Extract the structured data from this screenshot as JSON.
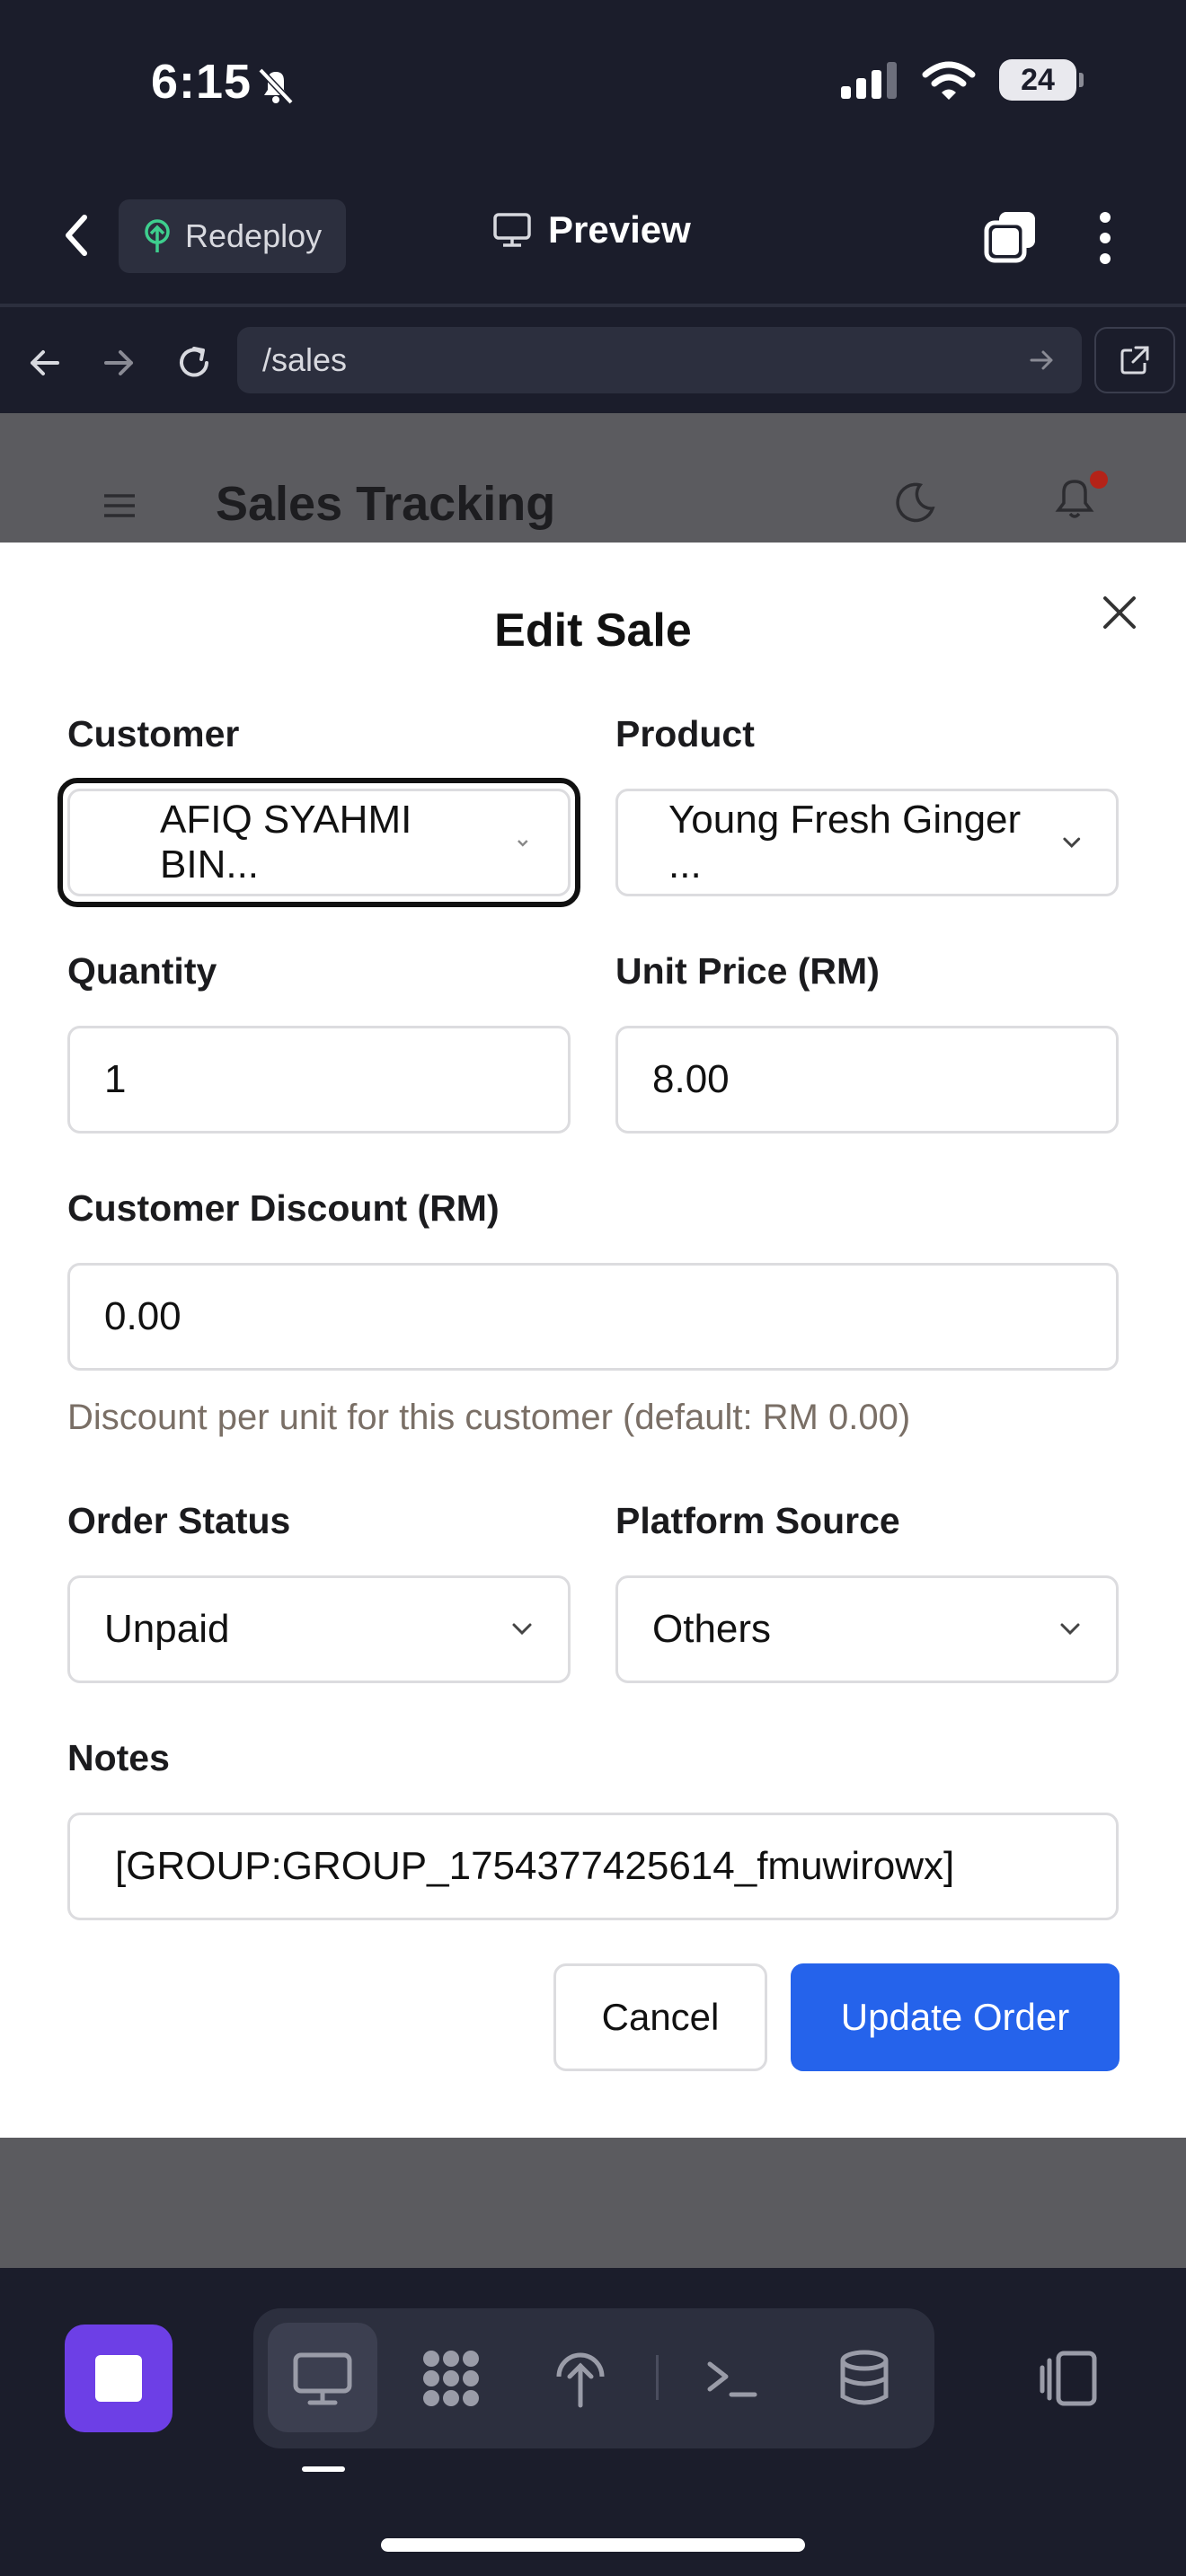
{
  "status_bar": {
    "time": "6:15",
    "battery": "24"
  },
  "header": {
    "redeploy_label": "Redeploy",
    "preview_label": "Preview"
  },
  "browser": {
    "url": "/sales"
  },
  "background_app": {
    "title": "Sales Tracking"
  },
  "modal": {
    "title": "Edit Sale",
    "customer": {
      "label": "Customer",
      "value": "AFIQ SYAHMI BIN..."
    },
    "product": {
      "label": "Product",
      "value": "Young Fresh Ginger ..."
    },
    "quantity": {
      "label": "Quantity",
      "value": "1"
    },
    "unit_price": {
      "label": "Unit Price (RM)",
      "value": "8.00"
    },
    "discount": {
      "label": "Customer Discount (RM)",
      "value": "0.00",
      "help": "Discount per unit for this customer (default: RM 0.00)"
    },
    "order_status": {
      "label": "Order Status",
      "value": "Unpaid"
    },
    "platform_source": {
      "label": "Platform Source",
      "value": "Others"
    },
    "notes": {
      "label": "Notes",
      "value": "[GROUP:GROUP_1754377425614_fmuwirowx]"
    },
    "cancel_label": "Cancel",
    "update_label": "Update Order"
  },
  "colors": {
    "primary": "#2563eb",
    "stop_button": "#6d3fe6",
    "notification_dot": "#b42318"
  },
  "toolbar": {
    "icons": [
      "stop-icon",
      "desktop-icon",
      "grid-dots-icon",
      "deploy-icon",
      "terminal-icon",
      "database-icon",
      "device-icon"
    ]
  }
}
